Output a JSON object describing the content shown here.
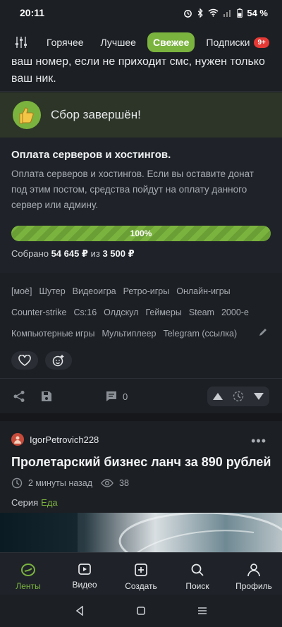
{
  "status": {
    "time": "20:11",
    "battery": "54 %"
  },
  "tabs": [
    {
      "label": "Горячее"
    },
    {
      "label": "Лучшее"
    },
    {
      "label": "Свежее"
    },
    {
      "label": "Подписки",
      "badge": "9+"
    }
  ],
  "post1": {
    "cutoff_text": "ваш номер, если не приходит смс, нужен только ваш ник.",
    "done_banner": "Сбор завершён!",
    "donation": {
      "title": "Оплата серверов и хостингов.",
      "description": "Оплата серверов и хостингов. Если вы оставите донат под этим постом, средства пойдут на оплату данного сервер или админу.",
      "progress_label": "100%",
      "progress": 1.0,
      "collected_prefix": "Собрано",
      "collected_amount": "54 645 ₽",
      "collected_mid": "из",
      "goal_amount": "3 500 ₽"
    },
    "tags": [
      "[моё]",
      "Шутер",
      "Видеоигра",
      "Ретро-игры",
      "Онлайн-игры",
      "Counter-strike",
      "Cs:16",
      "Олдскул",
      "Геймеры",
      "Steam",
      "2000-е",
      "Компьютерные игры",
      "Мультиплеер",
      "Telegram (ссылка)"
    ],
    "comments_count": "0"
  },
  "post2": {
    "author": "IgorPetrovich228",
    "title": "Пролетарский бизнес ланч за 890 рублей",
    "time": "2 минуты назад",
    "views": "38",
    "series_label": "Серия",
    "series_link": "Еда"
  },
  "bottom_nav": [
    {
      "label": "Ленты",
      "icon": "feed-icon",
      "active": true
    },
    {
      "label": "Видео",
      "icon": "video-icon"
    },
    {
      "label": "Создать",
      "icon": "plus-icon"
    },
    {
      "label": "Поиск",
      "icon": "search-icon"
    },
    {
      "label": "Профиль",
      "icon": "profile-icon"
    }
  ],
  "colors": {
    "accent": "#7bb33f",
    "background": "#1c1f24",
    "badge": "#e53935"
  }
}
